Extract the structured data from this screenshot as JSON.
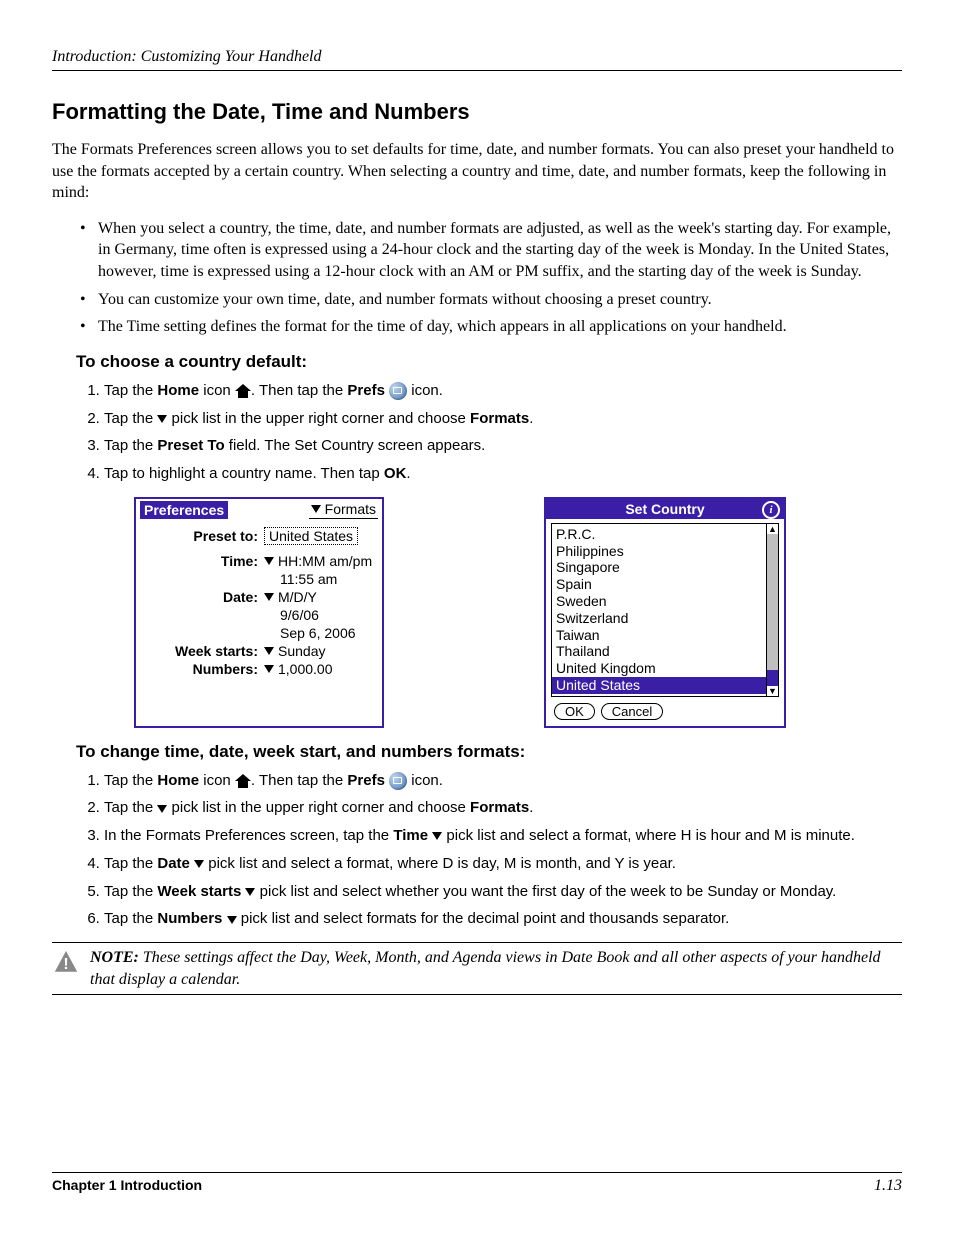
{
  "header": {
    "running": "Introduction: Customizing Your Handheld"
  },
  "title": "Formatting the Date, Time and Numbers",
  "intro": "The Formats Preferences screen allows you to set defaults for time, date, and number formats. You can also preset your handheld to use the formats accepted by a certain country. When selecting a country and time, date, and number formats, keep the following in mind:",
  "bullets": [
    "When you select a country, the time, date, and number formats are adjusted, as well as the week's starting day. For example, in Germany, time often is expressed using a 24-hour clock and the starting day of the week is Monday. In the United States, however, time is expressed using a 12-hour clock with an AM or PM suffix, and the starting day of the week is Sunday.",
    "You can customize your own time, date, and number formats without choosing a preset country.",
    "The Time setting defines the format for the time of day, which appears in all applications on your handheld."
  ],
  "proc1": {
    "heading": "To choose a country default:",
    "s1a": "Tap the ",
    "s1b": "Home",
    "s1c": " icon ",
    "s1d": ". Then tap the ",
    "s1e": "Prefs",
    "s1f": " icon.",
    "s2a": "Tap the ",
    "s2b": " pick list in the upper right corner and choose ",
    "s2c": "Formats",
    "s2d": ".",
    "s3a": "Tap the ",
    "s3b": "Preset To",
    "s3c": " field. The Set Country screen appears.",
    "s4a": "Tap to highlight a country name. Then tap ",
    "s4b": "OK",
    "s4c": "."
  },
  "prefs_mock": {
    "title_left": "Preferences",
    "title_right": "Formats",
    "preset_label": "Preset to:",
    "preset_value": "United States",
    "time_label": "Time:",
    "time_fmt": "HH:MM am/pm",
    "time_sample": "11:55 am",
    "date_label": "Date:",
    "date_fmt": "M/D/Y",
    "date_sample1": "9/6/06",
    "date_sample2": "Sep 6, 2006",
    "week_label": "Week starts:",
    "week_value": "Sunday",
    "num_label": "Numbers:",
    "num_value": "1,000.00"
  },
  "country_mock": {
    "title": "Set Country",
    "items": [
      "P.R.C.",
      "Philippines",
      "Singapore",
      "Spain",
      "Sweden",
      "Switzerland",
      "Taiwan",
      "Thailand",
      "United Kingdom",
      "United States"
    ],
    "selected_index": 9,
    "ok": "OK",
    "cancel": "Cancel"
  },
  "proc2": {
    "heading": "To change time, date, week start, and numbers formats:",
    "s1a": "Tap the ",
    "s1b": "Home",
    "s1c": " icon ",
    "s1d": ". Then tap the ",
    "s1e": "Prefs",
    "s1f": " icon.",
    "s2a": "Tap the ",
    "s2b": " pick list in the upper right corner and choose ",
    "s2c": "Formats",
    "s2d": ".",
    "s3a": "In the Formats Preferences screen, tap the ",
    "s3b": "Time",
    "s3c": " pick list and select a format, where H is hour and M is minute.",
    "s4a": "Tap the ",
    "s4b": "Date",
    "s4c": " pick list and select a format, where D is day, M is month, and Y is year.",
    "s5a": "Tap the ",
    "s5b": "Week starts",
    "s5c": " pick list and select whether you want the first day of the week to be Sunday or Monday.",
    "s6a": "Tap the ",
    "s6b": "Numbers",
    "s6c": " pick list and select formats for the decimal point and thousands separator."
  },
  "note": {
    "label": "NOTE:",
    "text": " These settings affect the Day, Week, Month, and Agenda views in Date Book and all other aspects of your handheld that display a calendar."
  },
  "footer": {
    "chapter": "Chapter 1 Introduction",
    "page": "1.13"
  }
}
